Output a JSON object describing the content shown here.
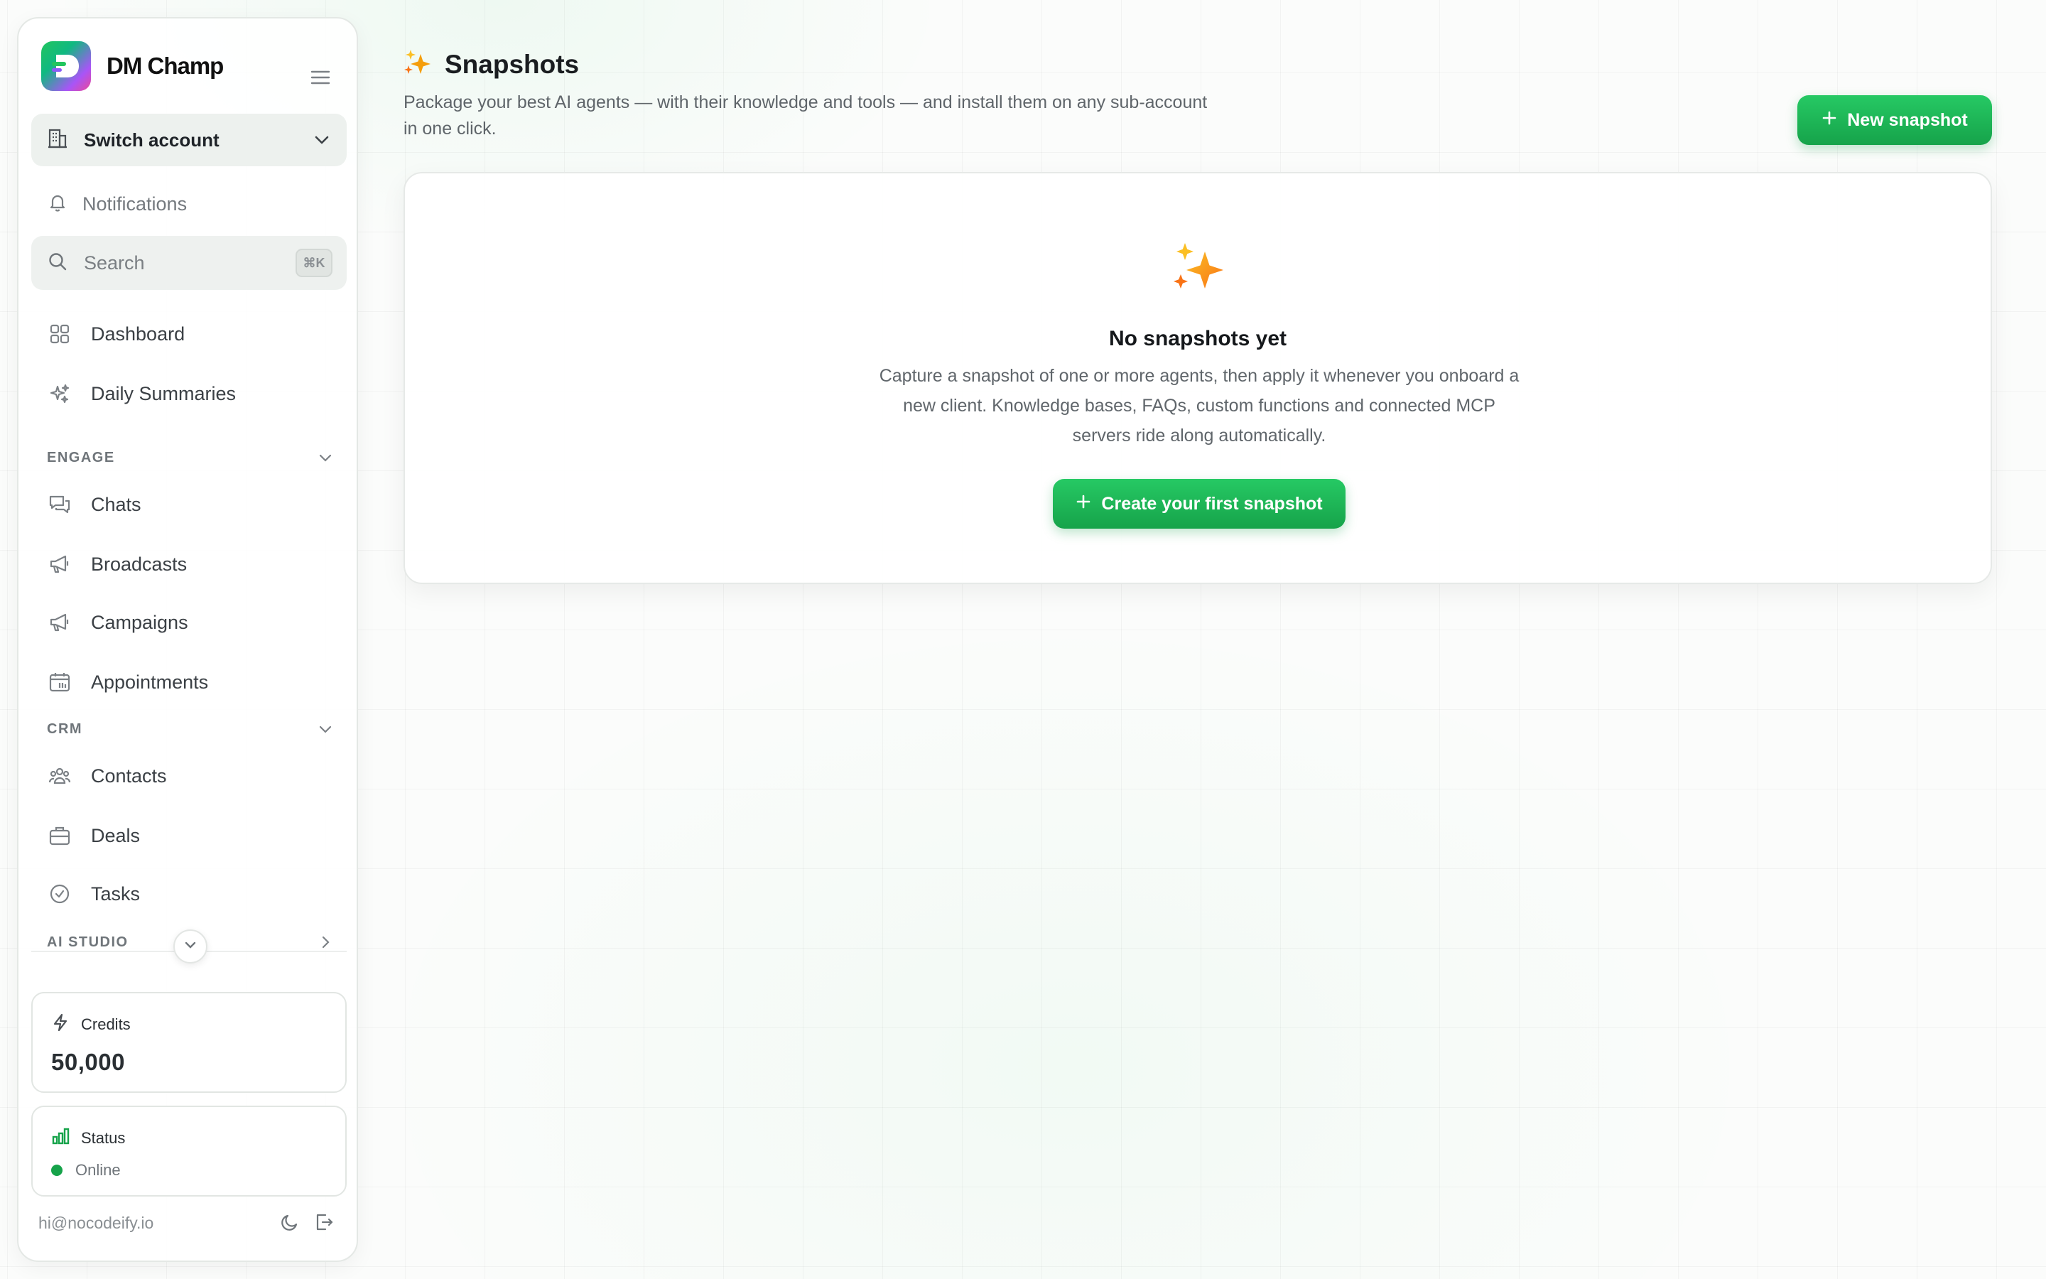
{
  "brand": {
    "name": "DM Champ",
    "logo_letter": "D"
  },
  "sidebar": {
    "switch_account": "Switch account",
    "notifications": "Notifications",
    "search": {
      "label": "Search",
      "shortcut": "⌘K"
    },
    "items_top": [
      {
        "label": "Dashboard",
        "icon": "grid-icon"
      },
      {
        "label": "Daily Summaries",
        "icon": "sparkles-icon"
      }
    ],
    "sections": {
      "engage": "ENGAGE",
      "crm": "CRM",
      "ai_studio": "AI STUDIO"
    },
    "engage_items": [
      {
        "label": "Chats",
        "icon": "chat-icon"
      },
      {
        "label": "Broadcasts",
        "icon": "megaphone-icon"
      },
      {
        "label": "Campaigns",
        "icon": "megaphone-icon"
      },
      {
        "label": "Appointments",
        "icon": "calendar-icon"
      }
    ],
    "crm_items": [
      {
        "label": "Contacts",
        "icon": "users-icon"
      },
      {
        "label": "Deals",
        "icon": "briefcase-icon"
      },
      {
        "label": "Tasks",
        "icon": "check-circle-icon"
      }
    ],
    "credits": {
      "label": "Credits",
      "value": "50,000"
    },
    "status": {
      "label": "Status",
      "value": "Online",
      "color": "#16a34a"
    },
    "footer_email": "hi@nocodeify.io"
  },
  "main": {
    "title": "Snapshots",
    "subtitle": "Package your best AI agents — with their knowledge and tools — and install them on any sub-account in one click.",
    "new_button": "New snapshot",
    "empty": {
      "title": "No snapshots yet",
      "description": "Capture a snapshot of one or more agents, then apply it whenever you onboard a new client. Knowledge bases, FAQs, custom functions and connected MCP servers ride along automatically.",
      "cta": "Create your first snapshot"
    }
  },
  "colors": {
    "accent": "#22c55e",
    "accent_dark": "#16a34a",
    "sparkle": "#f59e0b"
  }
}
